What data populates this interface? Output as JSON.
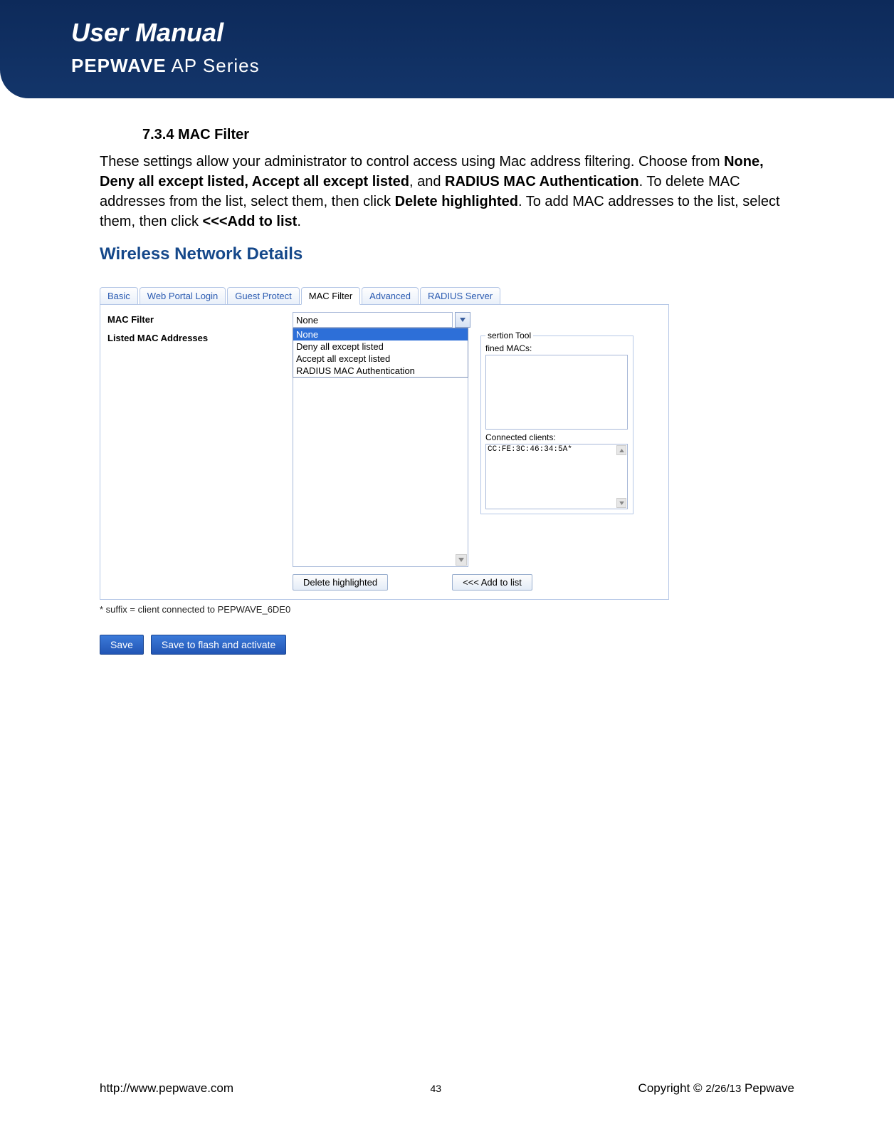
{
  "header": {
    "title": "User Manual",
    "brand_bold": "PEPWAVE",
    "brand_light": " AP Series"
  },
  "section": {
    "heading": "7.3.4 MAC Filter",
    "para_1": "These settings allow your administrator to control access using Mac address filtering. Choose from ",
    "bold_1": "None, Deny all except listed, Accept all except listed",
    "para_2": ", and ",
    "bold_2": "RADIUS MAC Authentication",
    "para_3": ". To delete MAC addresses from the list, select them, then click ",
    "bold_3": "Delete highlighted",
    "para_4": ". To add MAC addresses to the list, select them, then click ",
    "bold_4": "<<<Add to list",
    "para_5": "."
  },
  "panel": {
    "title": "Wireless Network Details",
    "tabs": [
      "Basic",
      "Web Portal Login",
      "Guest Protect",
      "MAC Filter",
      "Advanced",
      "RADIUS Server"
    ],
    "active_tab_index": 3,
    "mac_filter_label": "MAC Filter",
    "listed_label": "Listed MAC Addresses",
    "dropdown_value": "None",
    "dropdown_options": [
      "None",
      "Deny all except listed",
      "Accept all except listed",
      "RADIUS MAC Authentication"
    ],
    "dropdown_selected_index": 0,
    "insertion_legend": "sertion Tool",
    "predefined_label": "fined MACs:",
    "connected_label": "Connected clients:",
    "connected_clients": [
      "CC:FE:3C:46:34:5A*"
    ],
    "delete_btn": "Delete highlighted",
    "add_btn": "<<< Add to list",
    "suffix_note": "* suffix = client connected to PEPWAVE_6DE0",
    "save_btn": "Save",
    "save_flash_btn": "Save to flash and activate"
  },
  "footer": {
    "url": "http://www.pepwave.com",
    "page": "43",
    "copyright_prefix": "Copyright © ",
    "date": "2/26/13",
    "company": " Pepwave"
  }
}
